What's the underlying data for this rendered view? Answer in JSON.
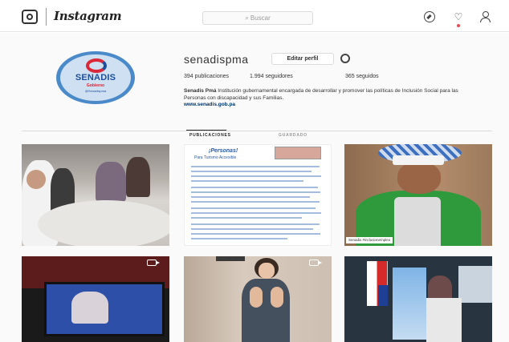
{
  "nav": {
    "logo": "Instagram",
    "search_placeholder": "Buscar",
    "icons": [
      "camera-icon",
      "compass-icon",
      "heart-icon",
      "user-icon"
    ]
  },
  "profile": {
    "username": "senadispma",
    "edit_button": "Editar perfil",
    "stats": {
      "posts": "394 publicaciones",
      "followers": "1.994 seguidores",
      "following": "365 seguidos"
    },
    "bio_name": "Senadis Pmá",
    "bio_text": "Institución gubernamental encargada de desarrollar y promover las políticas de Inclusión Social para las Personas con discapacidad y sus Familias.",
    "website": "www.senadis.gob.pa",
    "avatar": {
      "name": "SENADIS",
      "sub": "Gobierno",
      "handle": "@Senadispma"
    }
  },
  "tabs": [
    "PUBLICACIONES",
    "GUARDADO"
  ],
  "posts": {
    "doc_title": "¡Personas!",
    "doc_subtitle": "Para Turismo Accesible",
    "chef_caption": "Senadis #inclusionempleo"
  },
  "colors": {
    "accent": "#003569",
    "brand_blue": "#1d4f9c",
    "brand_red": "#d8283a",
    "notification": "#ed4956"
  }
}
